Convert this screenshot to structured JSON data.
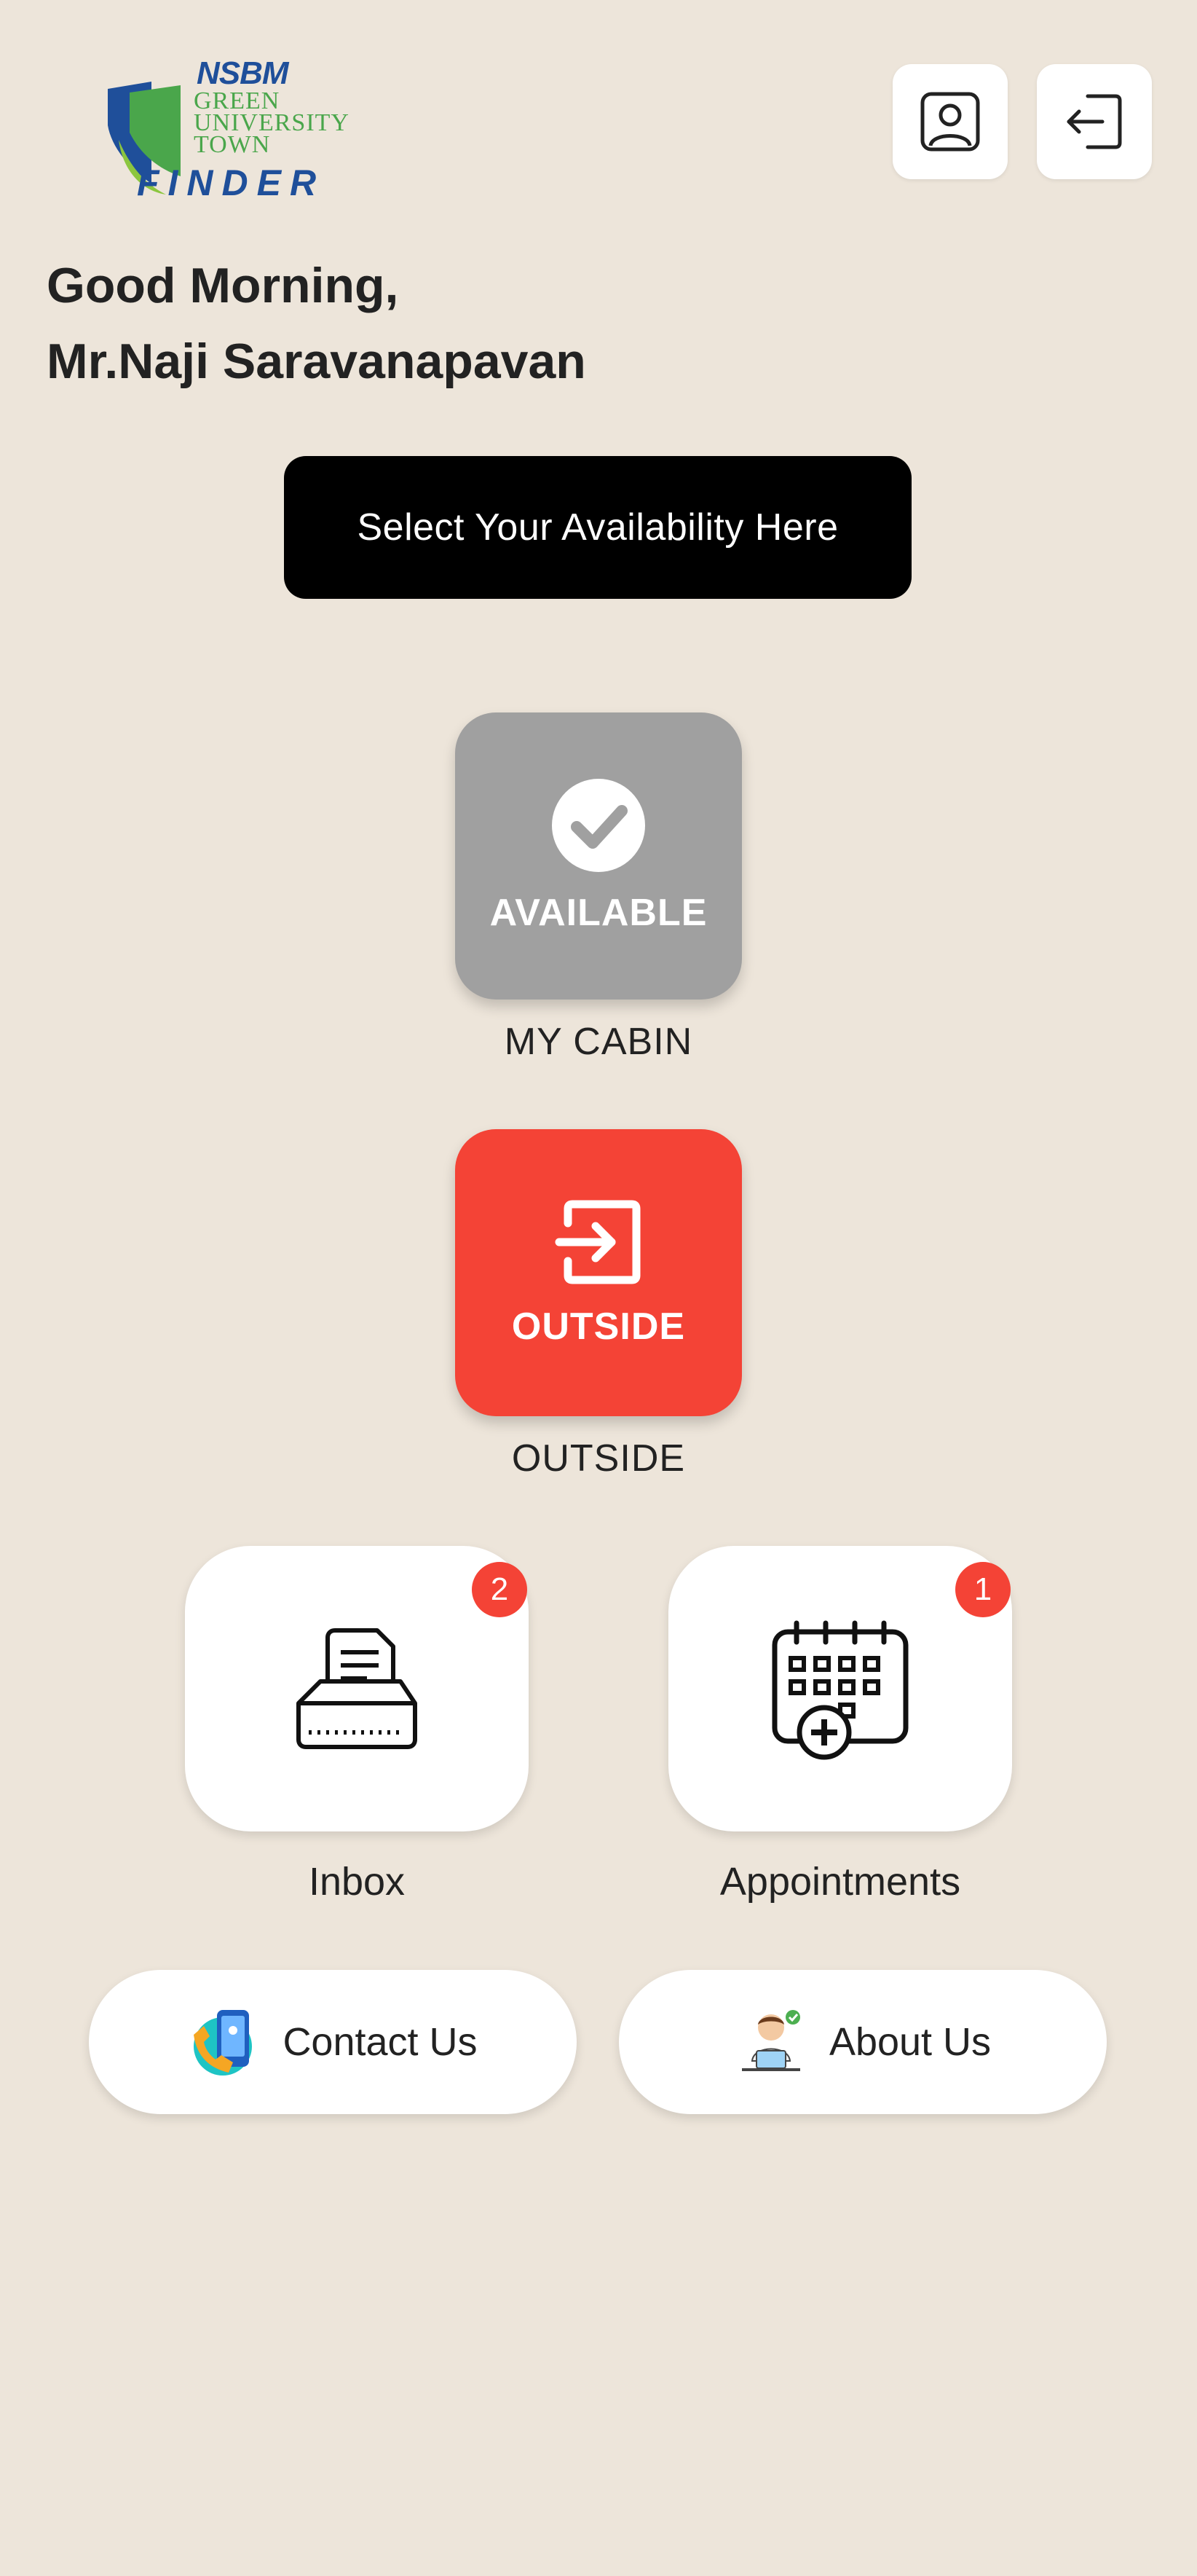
{
  "header": {
    "logo": {
      "brand": "NSBM",
      "lines": [
        "GREEN",
        "UNIVERSITY",
        "TOWN"
      ],
      "app_name": "FINDER"
    },
    "profile_icon": "person-portrait-icon",
    "logout_icon": "logout-icon"
  },
  "greeting": {
    "salutation": "Good Morning,",
    "name": "Mr.Naji Saravanapavan"
  },
  "availability_button": {
    "label": "Select Your Availability Here"
  },
  "status_tiles": [
    {
      "label": "AVAILABLE",
      "caption": "MY CABIN",
      "icon": "check-circle-icon",
      "color": "#a0a0a0"
    },
    {
      "label": "OUTSIDE",
      "caption": "OUTSIDE",
      "icon": "exit-icon",
      "color": "#f44336"
    }
  ],
  "cards": [
    {
      "label": "Inbox",
      "badge": "2",
      "icon": "inbox-tray-icon"
    },
    {
      "label": "Appointments",
      "badge": "1",
      "icon": "calendar-add-icon"
    }
  ],
  "links": [
    {
      "label": "Contact Us",
      "icon": "contact-phone-icon"
    },
    {
      "label": "About Us",
      "icon": "about-person-icon"
    }
  ],
  "colors": {
    "background": "#ede5da",
    "accent_red": "#f44336",
    "available_gray": "#a0a0a0",
    "primary_button": "#000000"
  }
}
